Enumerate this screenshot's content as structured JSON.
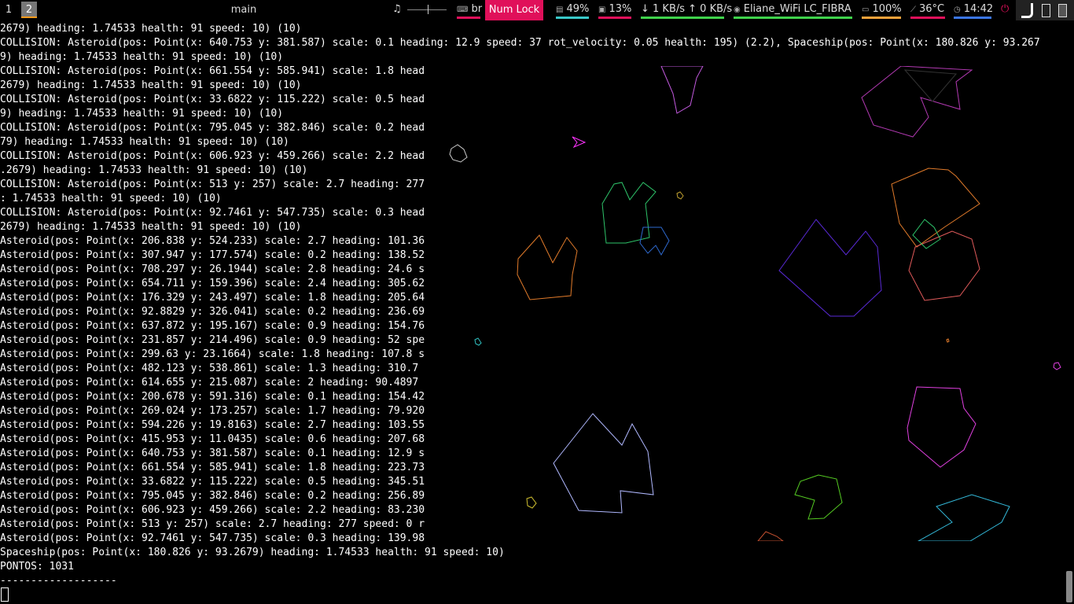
{
  "bar": {
    "workspaces": [
      "1",
      "2"
    ],
    "title": "main",
    "music_icon": "music-note-icon",
    "keyboard_layout": "br",
    "num_lock": "Num Lock",
    "memory": "49%",
    "cpu": "13%",
    "net": "↓ 1 KB/s ↑ 0 KB/s",
    "wifi": "Eliane_WiFi LC_FIBRA",
    "battery": "100%",
    "temp": "36°C",
    "clock": "14:42",
    "colors": {
      "green": "#3fd34b",
      "red": "#e0105a",
      "orange": "#f9a33a",
      "blue": "#3a76e8",
      "cyan": "#39c9c9"
    }
  },
  "terminal": {
    "lines": [
      "2679) heading: 1.74533 health: 91 speed: 10) (10)",
      "COLLISION: Asteroid(pos: Point(x: 640.753 y: 381.587) scale: 0.1 heading: 12.9 speed: 37 rot_velocity: 0.05 health: 195) (2.2), Spaceship(pos: Point(x: 180.826 y: 93.267",
      "9) heading: 1.74533 health: 91 speed: 10) (10)",
      "COLLISION: Asteroid(pos: Point(x: 661.554 y: 585.941) scale: 1.8 head",
      "2679) heading: 1.74533 health: 91 speed: 10) (10)",
      "COLLISION: Asteroid(pos: Point(x: 33.6822 y: 115.222) scale: 0.5 head",
      "9) heading: 1.74533 health: 91 speed: 10) (10)",
      "COLLISION: Asteroid(pos: Point(x: 795.045 y: 382.846) scale: 0.2 head",
      "79) heading: 1.74533 health: 91 speed: 10) (10)",
      "COLLISION: Asteroid(pos: Point(x: 606.923 y: 459.266) scale: 2.2 head",
      ".2679) heading: 1.74533 health: 91 speed: 10) (10)",
      "COLLISION: Asteroid(pos: Point(x: 513 y: 257) scale: 2.7 heading: 277",
      ": 1.74533 health: 91 speed: 10) (10)",
      "COLLISION: Asteroid(pos: Point(x: 92.7461 y: 547.735) scale: 0.3 head",
      "2679) heading: 1.74533 health: 91 speed: 10) (10)",
      "Asteroid(pos: Point(x: 206.838 y: 524.233) scale: 2.7 heading: 101.36",
      "Asteroid(pos: Point(x: 307.947 y: 177.574) scale: 0.2 heading: 138.52",
      "Asteroid(pos: Point(x: 708.297 y: 26.1944) scale: 2.8 heading: 24.6 s",
      "Asteroid(pos: Point(x: 654.711 y: 159.396) scale: 2.4 heading: 305.62",
      "Asteroid(pos: Point(x: 176.329 y: 243.497) scale: 1.8 heading: 205.64",
      "Asteroid(pos: Point(x: 92.8829 y: 326.041) scale: 0.2 heading: 236.69",
      "Asteroid(pos: Point(x: 637.872 y: 195.167) scale: 0.9 heading: 154.76",
      "Asteroid(pos: Point(x: 231.857 y: 214.496) scale: 0.9 heading: 52 spe",
      "Asteroid(pos: Point(x: 299.63 y: 23.1664) scale: 1.8 heading: 107.8 s",
      "Asteroid(pos: Point(x: 482.123 y: 538.861) scale: 1.3 heading: 310.7",
      "Asteroid(pos: Point(x: 614.655 y: 215.087) scale: 2 heading: 90.4897",
      "Asteroid(pos: Point(x: 200.678 y: 591.316) scale: 0.1 heading: 154.42",
      "Asteroid(pos: Point(x: 269.024 y: 173.257) scale: 1.7 heading: 79.920",
      "Asteroid(pos: Point(x: 594.226 y: 19.8163) scale: 2.7 heading: 103.55",
      "Asteroid(pos: Point(x: 415.953 y: 11.0435) scale: 0.6 heading: 207.68",
      "Asteroid(pos: Point(x: 640.753 y: 381.587) scale: 0.1 heading: 12.9 s",
      "Asteroid(pos: Point(x: 661.554 y: 585.941) scale: 1.8 heading: 223.73",
      "Asteroid(pos: Point(x: 33.6822 y: 115.222) scale: 0.5 heading: 345.51",
      "Asteroid(pos: Point(x: 795.045 y: 382.846) scale: 0.2 heading: 256.89",
      "Asteroid(pos: Point(x: 606.923 y: 459.266) scale: 2.2 heading: 83.230",
      "Asteroid(pos: Point(x: 513 y: 257) scale: 2.7 heading: 277 speed: 0 r",
      "Asteroid(pos: Point(x: 92.7461 y: 547.735) scale: 0.3 heading: 139.98",
      "Spaceship(pos: Point(x: 180.826 y: 93.2679) heading: 1.74533 health: 91 speed: 10)",
      "PONTOS: 1031",
      "-------------------",
      ""
    ]
  },
  "game": {
    "ship_color": "#ff33ff"
  }
}
